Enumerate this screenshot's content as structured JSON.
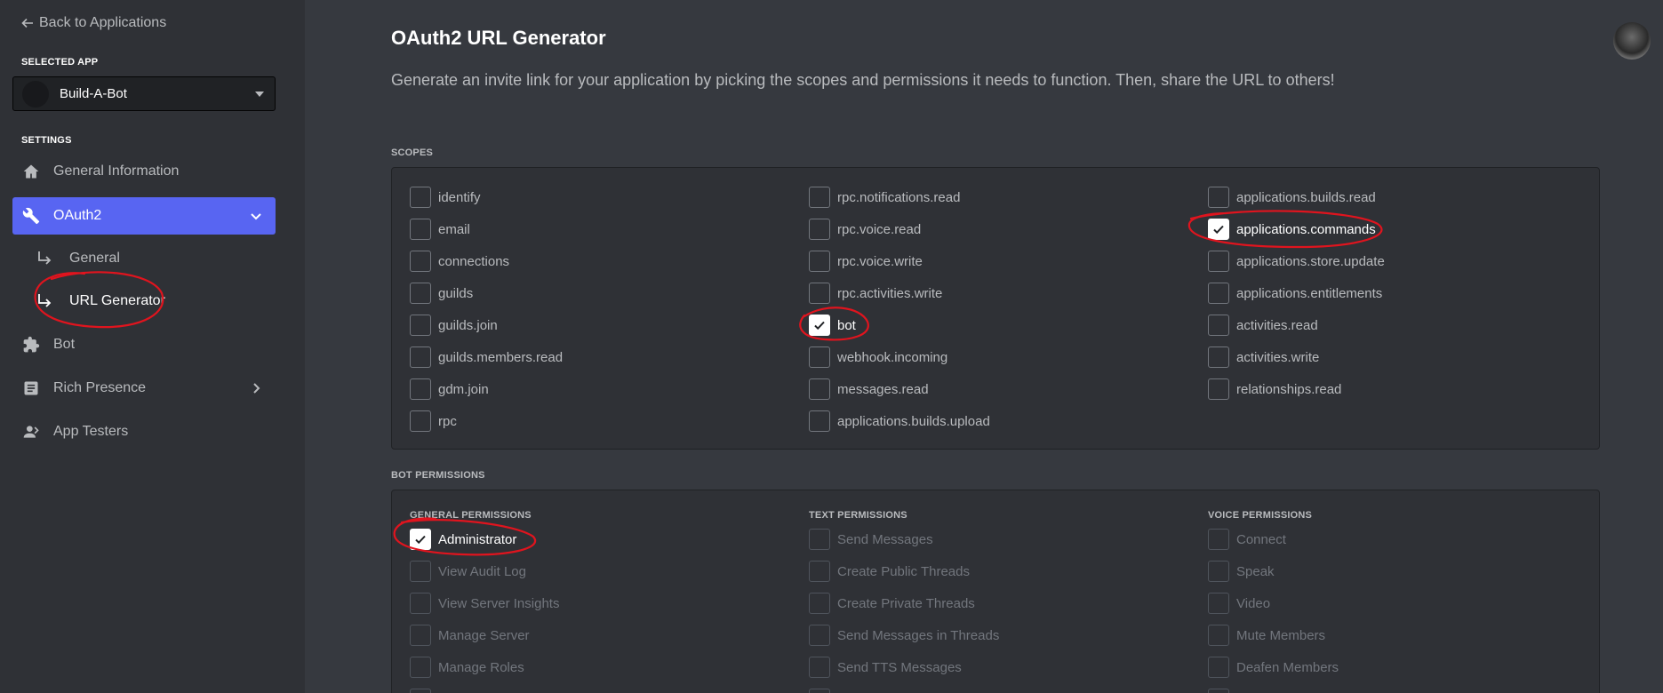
{
  "sidebar": {
    "back_label": "Back to Applications",
    "selected_app_label": "SELECTED APP",
    "selected_app_name": "Build-A-Bot",
    "settings_label": "SETTINGS",
    "items": [
      {
        "label": "General Information",
        "icon": "home-icon"
      },
      {
        "label": "OAuth2",
        "icon": "wrench-icon",
        "active": true,
        "expanded": true
      },
      {
        "label": "Bot",
        "icon": "puzzle-icon"
      },
      {
        "label": "Rich Presence",
        "icon": "document-icon",
        "has_chevron": true
      },
      {
        "label": "App Testers",
        "icon": "user-icon"
      }
    ],
    "sub_items": [
      {
        "label": "General"
      },
      {
        "label": "URL Generator",
        "active": true
      }
    ]
  },
  "main": {
    "title": "OAuth2 URL Generator",
    "description": "Generate an invite link for your application by picking the scopes and permissions it needs to function. Then, share the URL to others!",
    "scopes_label": "SCOPES",
    "scopes": [
      [
        "identify",
        "email",
        "connections",
        "guilds",
        "guilds.join",
        "guilds.members.read",
        "gdm.join",
        "rpc"
      ],
      [
        "rpc.notifications.read",
        "rpc.voice.read",
        "rpc.voice.write",
        "rpc.activities.write",
        "bot",
        "webhook.incoming",
        "messages.read",
        "applications.builds.upload"
      ],
      [
        "applications.builds.read",
        "applications.commands",
        "applications.store.update",
        "applications.entitlements",
        "activities.read",
        "activities.write",
        "relationships.read"
      ]
    ],
    "checked_scopes": [
      "bot",
      "applications.commands"
    ],
    "bot_permissions_label": "BOT PERMISSIONS",
    "permission_groups": [
      {
        "title": "GENERAL PERMISSIONS",
        "items": [
          "Administrator",
          "View Audit Log",
          "View Server Insights",
          "Manage Server",
          "Manage Roles"
        ]
      },
      {
        "title": "TEXT PERMISSIONS",
        "items": [
          "Send Messages",
          "Create Public Threads",
          "Create Private Threads",
          "Send Messages in Threads",
          "Send TTS Messages"
        ]
      },
      {
        "title": "VOICE PERMISSIONS",
        "items": [
          "Connect",
          "Speak",
          "Video",
          "Mute Members",
          "Deafen Members"
        ]
      }
    ],
    "checked_permissions": [
      "Administrator"
    ]
  },
  "colors": {
    "accent": "#5865f2",
    "annotation": "#e0141e",
    "background": "#36393f",
    "sidebar": "#2f3136"
  }
}
